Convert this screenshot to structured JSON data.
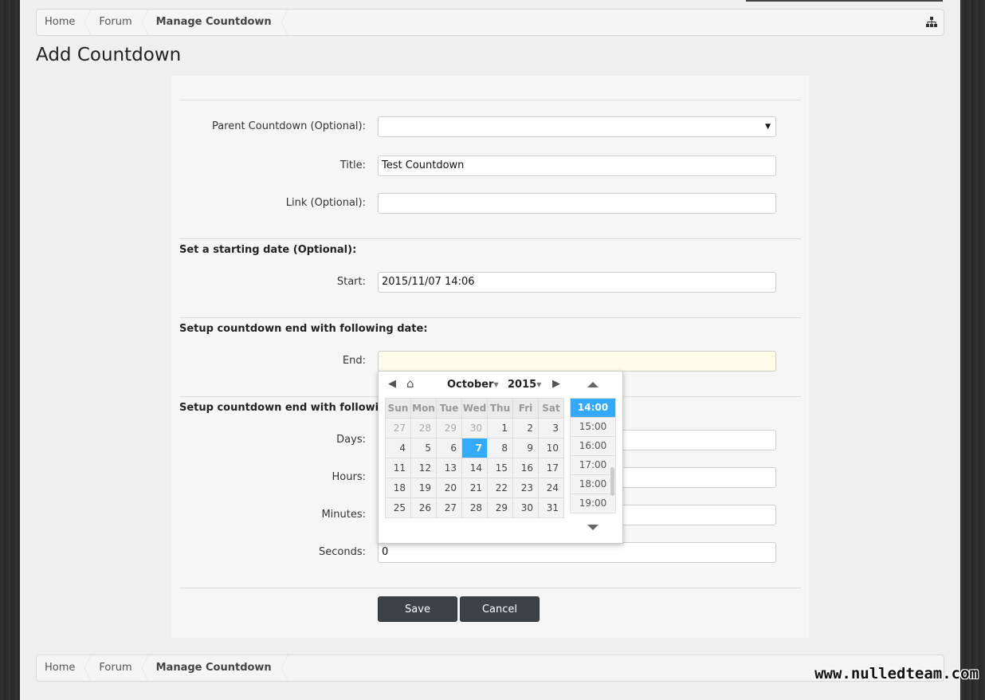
{
  "breadcrumb": {
    "items": [
      "Home",
      "Forum",
      "Manage Countdown"
    ]
  },
  "page": {
    "title": "Add Countdown"
  },
  "form": {
    "parent_label": "Parent Countdown (Optional):",
    "parent_value": "",
    "title_label": "Title:",
    "title_value": "Test Countdown",
    "link_label": "Link (Optional):",
    "link_value": "",
    "start_section": "Set a starting date (Optional):",
    "start_label": "Start:",
    "start_value": "2015/11/07 14:06",
    "end_date_section": "Setup countdown end with following date:",
    "end_label": "End:",
    "end_value": "",
    "end_duration_section": "Setup countdown end with following d",
    "days_label": "Days:",
    "hours_label": "Hours:",
    "minutes_label": "Minutes:",
    "seconds_label": "Seconds:",
    "seconds_value": "0",
    "save_label": "Save",
    "cancel_label": "Cancel"
  },
  "datepicker": {
    "month": "October",
    "year": "2015",
    "weekdays": [
      "Sun",
      "Mon",
      "Tue",
      "Wed",
      "Thu",
      "Fri",
      "Sat"
    ],
    "weeks": [
      [
        "27",
        "28",
        "29",
        "30",
        "1",
        "2",
        "3"
      ],
      [
        "4",
        "5",
        "6",
        "7",
        "8",
        "9",
        "10"
      ],
      [
        "11",
        "12",
        "13",
        "14",
        "15",
        "16",
        "17"
      ],
      [
        "18",
        "19",
        "20",
        "21",
        "22",
        "23",
        "24"
      ],
      [
        "25",
        "26",
        "27",
        "28",
        "29",
        "30",
        "31"
      ]
    ],
    "selected_day": "7",
    "times": [
      "14:00",
      "15:00",
      "16:00",
      "17:00",
      "18:00",
      "19:00"
    ],
    "selected_time": "14:00"
  },
  "watermark": "www.nulledteam.com",
  "colors": {
    "accent": "#33aaff",
    "button": "#3d4247"
  }
}
